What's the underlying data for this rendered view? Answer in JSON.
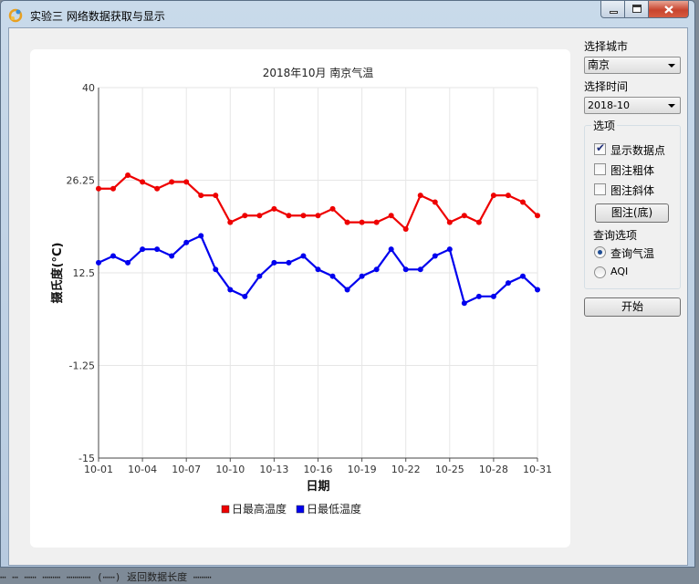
{
  "window": {
    "title": "实验三 网络数据获取与显示",
    "icon": "app-logo-icon"
  },
  "controls": {
    "city_label": "选择城市",
    "city_value": "南京",
    "time_label": "选择时间",
    "time_value": "2018-10",
    "options_group": "选项",
    "show_points": "显示数据点",
    "show_points_checked": true,
    "legend_bold": "图注粗体",
    "legend_bold_checked": false,
    "legend_italic": "图注斜体",
    "legend_italic_checked": false,
    "legend_pos_button": "图注(底)",
    "query_label": "查询选项",
    "query_temp": "查询气温",
    "query_temp_selected": true,
    "query_aqi": "AQI",
    "query_aqi_selected": false,
    "start_button": "开始"
  },
  "console_line": "⋯ ⋯  ⋯⋯ ⋯⋯⋯ ⋯⋯⋯⋯ (⋯⋯)  返回数据长度 ⋯⋯⋯",
  "chart_data": {
    "type": "line",
    "title": "2018年10月 南京气温",
    "xlabel": "日期",
    "ylabel": "摄氏度(°C)",
    "ylim": [
      -15,
      40
    ],
    "yticks": [
      "40",
      "26.25",
      "12.5",
      "-1.25",
      "-15"
    ],
    "xticks": [
      "10-01",
      "10-04",
      "10-07",
      "10-10",
      "10-13",
      "10-16",
      "10-19",
      "10-22",
      "10-25",
      "10-28",
      "10-31"
    ],
    "grid": true,
    "legend": "bottom",
    "x": [
      "10-01",
      "10-02",
      "10-03",
      "10-04",
      "10-05",
      "10-06",
      "10-07",
      "10-08",
      "10-09",
      "10-10",
      "10-11",
      "10-12",
      "10-13",
      "10-14",
      "10-15",
      "10-16",
      "10-17",
      "10-18",
      "10-19",
      "10-20",
      "10-21",
      "10-22",
      "10-23",
      "10-24",
      "10-25",
      "10-26",
      "10-27",
      "10-28",
      "10-29",
      "10-30",
      "10-31"
    ],
    "series": [
      {
        "name": "日最高温度",
        "color": "#ee0000",
        "values": [
          25,
          25,
          27,
          26,
          25,
          26,
          26,
          24,
          24,
          20,
          21,
          21,
          22,
          21,
          21,
          21,
          22,
          20,
          20,
          20,
          21,
          19,
          24,
          23,
          20,
          21,
          20,
          24,
          24,
          23,
          21
        ]
      },
      {
        "name": "日最低温度",
        "color": "#0000ee",
        "values": [
          14,
          15,
          14,
          16,
          16,
          15,
          17,
          18,
          13,
          10,
          9,
          12,
          14,
          14,
          15,
          13,
          12,
          10,
          12,
          13,
          16,
          13,
          13,
          15,
          16,
          8,
          9,
          9,
          11,
          12,
          10
        ]
      }
    ]
  }
}
